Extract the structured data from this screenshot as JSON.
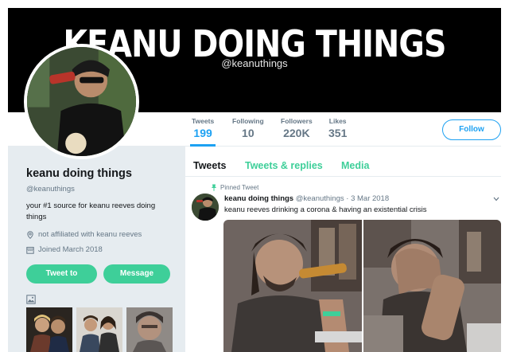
{
  "banner": {
    "title": "KEANU DOING THINGS",
    "handle": "@keanuthings"
  },
  "stats": [
    {
      "label": "Tweets",
      "value": "199",
      "active": true
    },
    {
      "label": "Following",
      "value": "10",
      "active": false
    },
    {
      "label": "Followers",
      "value": "220K",
      "active": false
    },
    {
      "label": "Likes",
      "value": "351",
      "active": false
    }
  ],
  "follow_label": "Follow",
  "profile": {
    "name": "keanu doing things",
    "handle": "@keanuthings",
    "bio": "your #1 source for keanu reeves doing things",
    "location": "not affiliated with keanu reeves",
    "joined": "Joined March 2018",
    "tweet_to_label": "Tweet to",
    "message_label": "Message"
  },
  "timeline": {
    "tabs": [
      "Tweets",
      "Tweets & replies",
      "Media"
    ],
    "pinned_label": "Pinned Tweet",
    "tweet": {
      "author": "keanu doing things",
      "handle": "@keanuthings",
      "date": "· 3 Mar 2018",
      "text": "keanu reeves drinking a corona & having an existential crisis"
    }
  },
  "colors": {
    "accent_blue": "#1da1f2",
    "accent_green": "#3ecf99",
    "page_gray": "#e6ecf0",
    "banner_bg": "#000000"
  },
  "icons": [
    "location-pin-icon",
    "calendar-icon",
    "photo-icon",
    "pin-icon",
    "chevron-down-icon"
  ]
}
